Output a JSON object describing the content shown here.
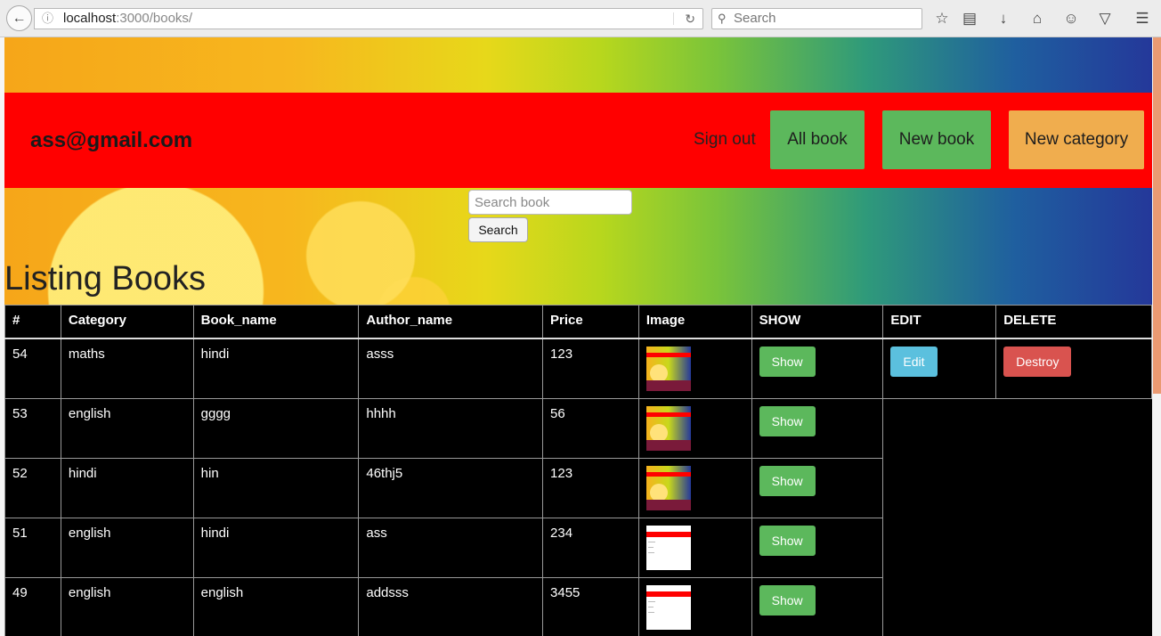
{
  "browser": {
    "url_host": "localhost",
    "url_rest": ":3000/books/",
    "search_placeholder": "Search"
  },
  "navbar": {
    "user_email": "ass@gmail.com",
    "sign_out": "Sign out",
    "all_book": "All book",
    "new_book": "New book",
    "new_category": "New category"
  },
  "search": {
    "placeholder": "Search book",
    "button": "Search"
  },
  "page_title": "Listing Books",
  "table": {
    "headers": [
      "#",
      "Category",
      "Book_name",
      "Author_name",
      "Price",
      "Image",
      "SHOW",
      "EDIT",
      "DELETE"
    ],
    "show_label": "Show",
    "edit_label": "Edit",
    "destroy_label": "Destroy",
    "rows": [
      {
        "id": "54",
        "category": "maths",
        "book_name": "hindi",
        "author_name": "asss",
        "price": "123",
        "thumb": "colorful"
      },
      {
        "id": "53",
        "category": "english",
        "book_name": "gggg",
        "author_name": "hhhh",
        "price": "56",
        "thumb": "colorful"
      },
      {
        "id": "52",
        "category": "hindi",
        "book_name": "hin",
        "author_name": "46thj5",
        "price": "123",
        "thumb": "colorful"
      },
      {
        "id": "51",
        "category": "english",
        "book_name": "hindi",
        "author_name": "ass",
        "price": "234",
        "thumb": "white"
      },
      {
        "id": "49",
        "category": "english",
        "book_name": "english",
        "author_name": "addsss",
        "price": "3455",
        "thumb": "white"
      }
    ]
  }
}
